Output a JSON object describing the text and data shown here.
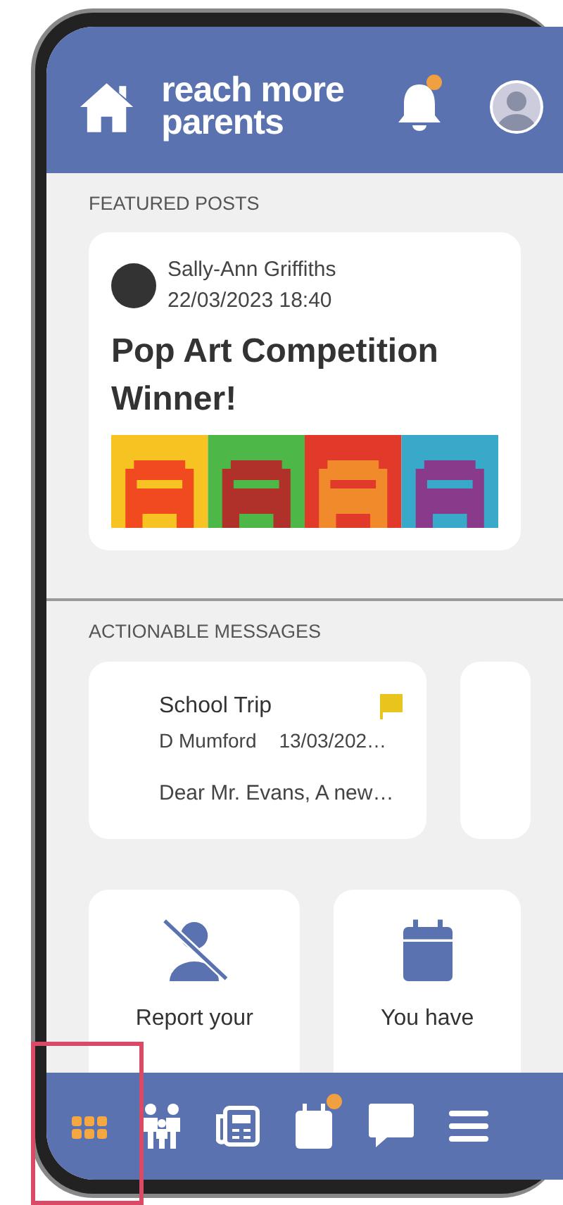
{
  "header": {
    "logo_lines": [
      "reach more",
      "parents"
    ],
    "notification": true
  },
  "featured": {
    "heading": "FEATURED POSTS",
    "posts": [
      {
        "author": "Sally-Ann Griffiths",
        "datetime": "22/03/2023 18:40",
        "title": "Pop Art Competition Winner!"
      }
    ]
  },
  "actionable": {
    "heading": "ACTIONABLE MESSAGES",
    "messages": [
      {
        "subject": "School Trip",
        "sender": "D Mumford",
        "date": "13/03/202…",
        "preview": "Dear Mr. Evans, A new…",
        "flagged": true
      }
    ]
  },
  "tiles": [
    {
      "kind": "absence",
      "text": "Report your"
    },
    {
      "kind": "calendar",
      "text": "You have"
    }
  ],
  "nav": [
    {
      "kind": "apps",
      "selected": true,
      "badge": false
    },
    {
      "kind": "family",
      "selected": false,
      "badge": false
    },
    {
      "kind": "news",
      "selected": false,
      "badge": false
    },
    {
      "kind": "calendar",
      "selected": false,
      "badge": true
    },
    {
      "kind": "messages",
      "selected": false,
      "badge": false
    },
    {
      "kind": "menu",
      "selected": false,
      "badge": false
    }
  ]
}
